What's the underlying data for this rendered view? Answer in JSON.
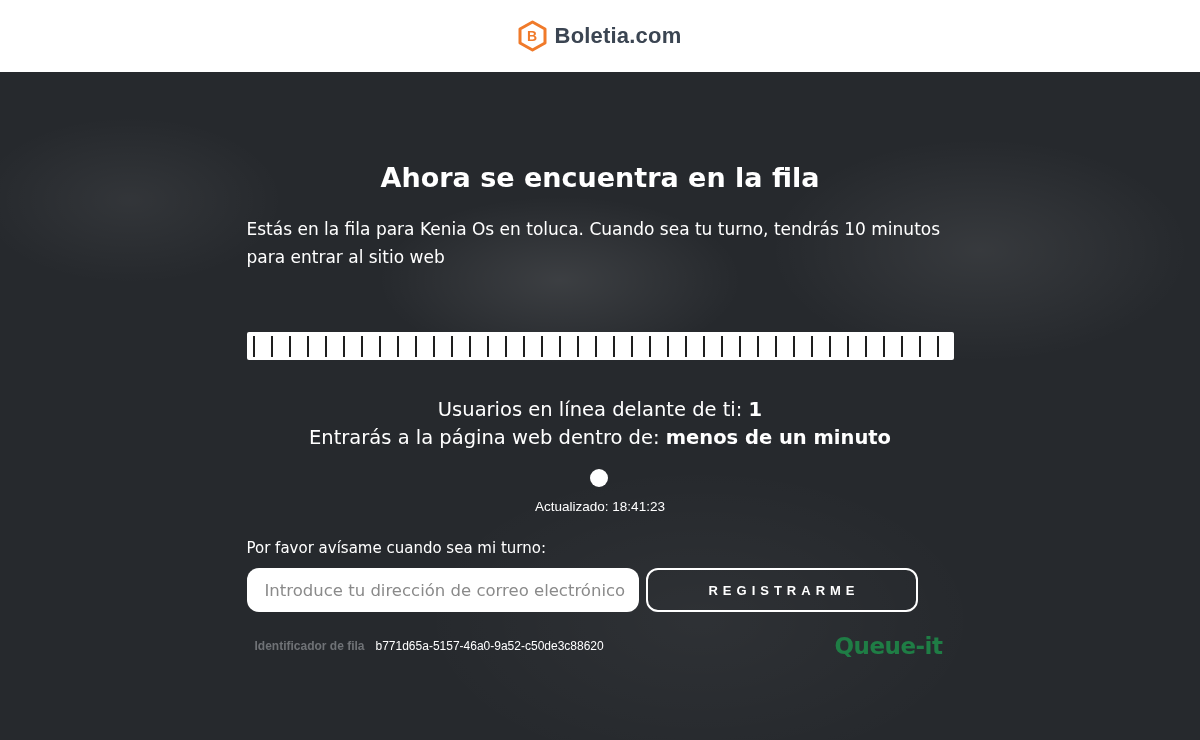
{
  "header": {
    "logo_mark": "B",
    "logo_text": "Boletia.com"
  },
  "queue": {
    "title": "Ahora se encuentra en la fila",
    "intro": "Estás en la fila para Kenia Os en toluca. Cuando sea tu turno, tendrás 10 minutos para entrar al sitio web",
    "progress": {
      "level": 1
    },
    "users_ahead": "Usuarios en línea delante de ti: **1**",
    "wait_time": "Entrarás a la página web dentro de: **menos de un minuto**",
    "updated": "Actualizado: 18:41:23"
  },
  "notify": {
    "label": "Por favor avísame cuando sea mi turno:",
    "email": {
      "placeholder": "Introduce tu dirección de correo electrónico"
    },
    "button": "REGISTRARME"
  },
  "footer": {
    "queue_id_label": "Identificador de fila",
    "queue_id": "b771d65a-5157-46a0-9a52-c50de3c88620",
    "brand": "Queue-it"
  }
}
